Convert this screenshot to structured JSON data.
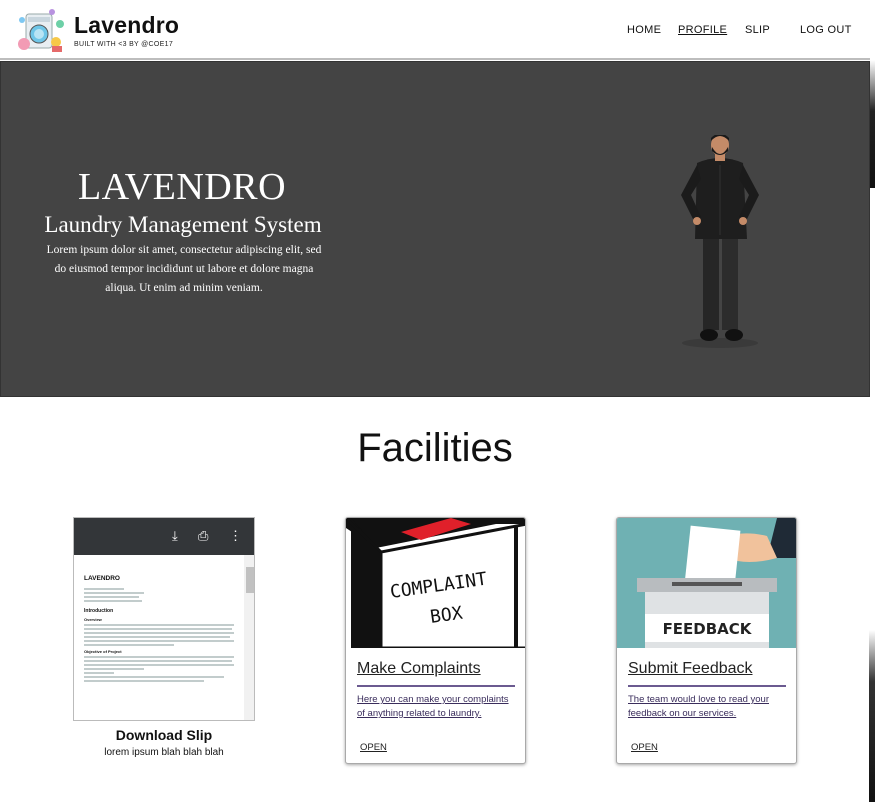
{
  "navbar": {
    "brand": "Lavendro",
    "tagline": "BUILT WITH <3 BY @COE17",
    "links": [
      "HOME",
      "PROFILE",
      "SLIP",
      "LOG OUT"
    ],
    "active": "PROFILE"
  },
  "hero": {
    "title": "LAVENDRO",
    "subtitle": "Laundry Management System",
    "text": "Lorem ipsum dolor sit amet, consectetur adipiscing elit, sed do eiusmod tempor incididunt ut labore et dolore magna aliqua. Ut enim ad minim veniam.",
    "background": "#444444"
  },
  "facilities": {
    "title": "Facilities",
    "slip": {
      "title": "Download Slip",
      "description": "lorem ipsum blah blah blah",
      "preview": {
        "doc_title": "LAVENDRO",
        "heading_intro": "Introduction",
        "heading_overview": "Overview",
        "heading_objective": "Objective of Project"
      }
    },
    "cards": [
      {
        "title": "Make Complaints",
        "text": "Here you can make your complaints of anything related to laundry.",
        "action": "OPEN",
        "image_text": [
          "COMPLAINT",
          "BOX"
        ]
      },
      {
        "title": "Submit Feedback",
        "text": "The team would love to read your feedback on our services.",
        "action": "OPEN",
        "image_text": [
          "FEEDBACK"
        ]
      }
    ]
  },
  "colors": {
    "hero_bg": "#444444",
    "accent_rule": "#6b5a90",
    "feedback_bg": "#6fb1b3"
  }
}
